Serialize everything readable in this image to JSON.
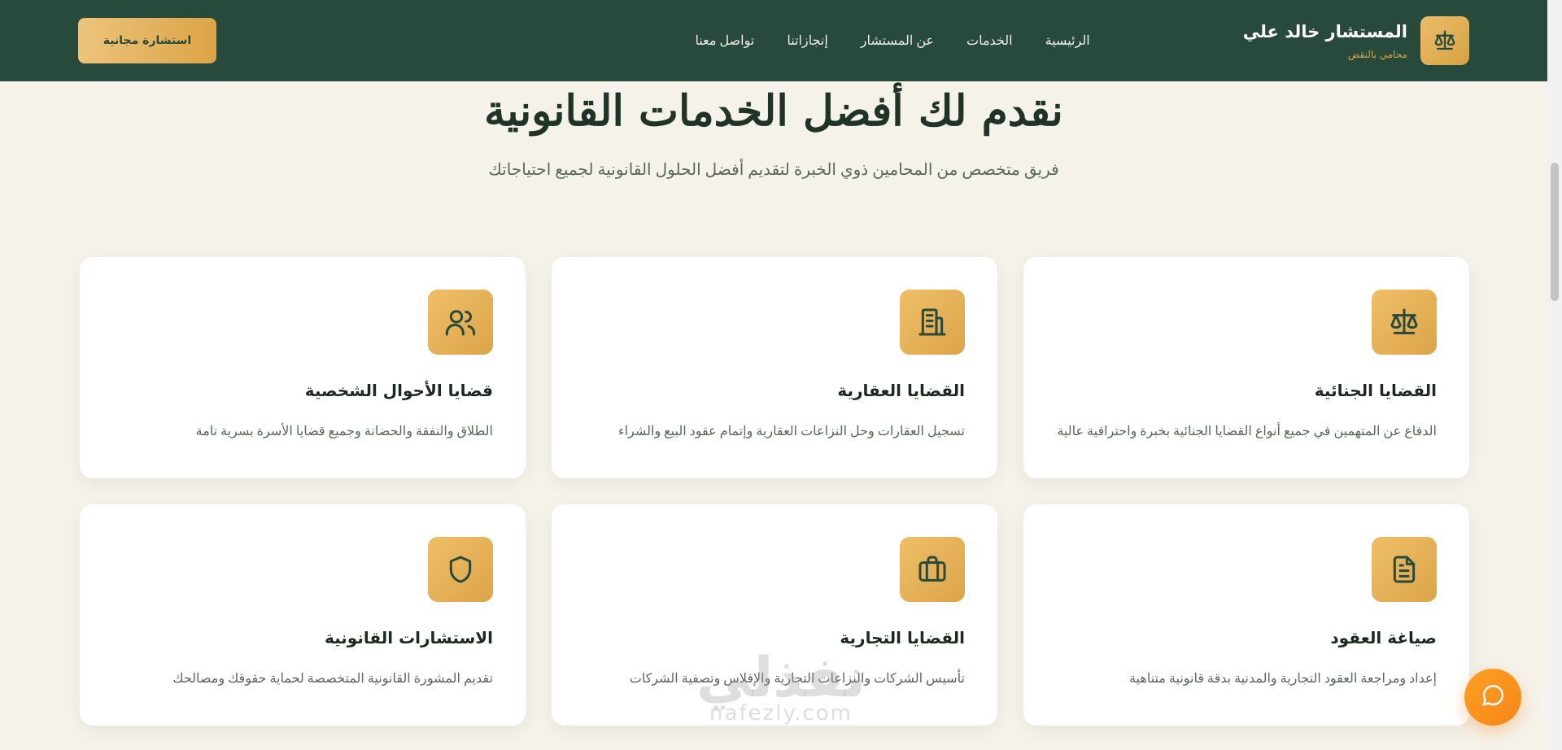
{
  "header": {
    "brand_title": "المستشار خالد علي",
    "brand_subtitle": "محامي بالنقض",
    "logo_icon": "scales-icon",
    "nav": [
      {
        "label": "الرئيسية"
      },
      {
        "label": "الخدمات"
      },
      {
        "label": "عن المستشار"
      },
      {
        "label": "إنجازاتنا"
      },
      {
        "label": "تواصل معنا"
      }
    ],
    "cta_label": "استشارة مجانية"
  },
  "hero": {
    "title": "نقدم لك أفضل الخدمات القانونية",
    "subtitle": "فريق متخصص من المحامين ذوي الخبرة لتقديم أفضل الحلول القانونية لجميع احتياجاتك"
  },
  "services": [
    {
      "title": "القضايا الجنائية",
      "desc": "الدفاع عن المتهمين في جميع أنواع القضايا الجنائية بخبرة واحترافية عالية",
      "icon": "scales-icon"
    },
    {
      "title": "القضايا العقارية",
      "desc": "تسجيل العقارات وحل النزاعات العقارية وإتمام عقود البيع والشراء",
      "icon": "building-icon"
    },
    {
      "title": "قضايا الأحوال الشخصية",
      "desc": "الطلاق والنفقة والحضانة وجميع قضايا الأسرة بسرية تامة",
      "icon": "users-icon"
    },
    {
      "title": "صياغة العقود",
      "desc": "إعداد ومراجعة العقود التجارية والمدنية بدقة قانونية متناهية",
      "icon": "document-icon"
    },
    {
      "title": "القضايا التجارية",
      "desc": "تأسيس الشركات والنزاعات التجارية والإفلاس وتصفية الشركات",
      "icon": "briefcase-icon"
    },
    {
      "title": "الاستشارات القانونية",
      "desc": "تقديم المشورة القانونية المتخصصة لحماية حقوقك ومصالحك",
      "icon": "shield-icon"
    }
  ],
  "watermark": {
    "main": "نفذلي",
    "sub": "nafezly.com"
  },
  "chat_icon": "chat-bubble-icon",
  "colors": {
    "header_bg": "#284a3c",
    "accent": "#dca44a",
    "page_bg": "#f5f2ea",
    "chat": "#f58518"
  }
}
